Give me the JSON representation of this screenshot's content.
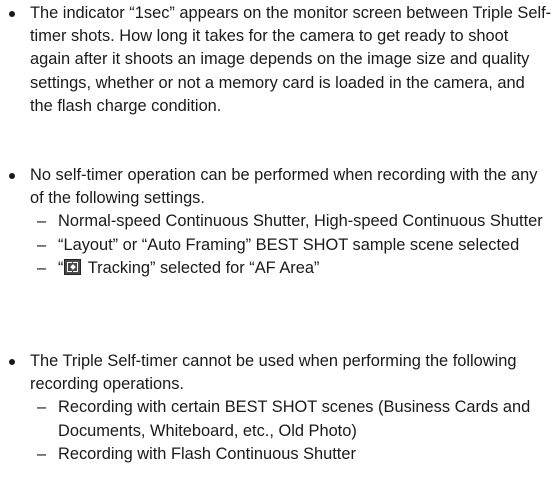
{
  "bullets": [
    {
      "text": "The indicator “1sec” appears on the monitor screen between Triple Self-timer shots. How long it takes for the camera to get ready to shoot again after it shoots an image depends on the image size and quality settings, whether or not a memory card is loaded in the camera, and the flash charge condition."
    },
    {
      "text": "No self-timer operation can be performed when recording with the any of the following settings.",
      "sub_items": [
        {
          "text": "Normal-speed Continuous Shutter, High-speed Continuous Shutter"
        },
        {
          "text": "“Layout” or “Auto Framing” BEST SHOT sample scene selected"
        },
        {
          "text_before_icon": "“",
          "icon": "af-tracking-icon",
          "text_after_icon": " Tracking” selected for “AF Area”"
        }
      ]
    },
    {
      "text": "The Triple Self-timer cannot be used when performing the following recording operations.",
      "sub_items": [
        {
          "text": "Recording with certain BEST SHOT scenes (Business Cards and Documents, Whiteboard, etc., Old Photo)"
        },
        {
          "text": "Recording with Flash Continuous Shutter"
        }
      ]
    }
  ]
}
